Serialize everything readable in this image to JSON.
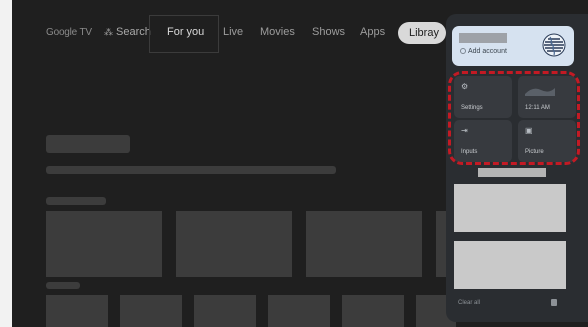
{
  "nav": {
    "logo_text": "Google TV",
    "search_label": "Search",
    "tabs": [
      {
        "label": "For you",
        "selected": true
      },
      {
        "label": "Live"
      },
      {
        "label": "Movies"
      },
      {
        "label": "Shows"
      },
      {
        "label": "Apps"
      },
      {
        "label": "Libray"
      }
    ]
  },
  "quick_settings": {
    "account": {
      "add_label": "Add account"
    },
    "tiles": [
      {
        "icon": "gear-icon",
        "label": "Settings"
      },
      {
        "icon": "clock-icon",
        "label": "12:11 AM"
      },
      {
        "icon": "input-icon",
        "label": "Inputs"
      },
      {
        "icon": "picture-icon",
        "label": "Picture"
      }
    ],
    "footer": {
      "clear_label": "Clear all",
      "trash_icon": "trash-icon"
    }
  },
  "colors": {
    "background": "#1f1f1f",
    "panel": "#2a2d31",
    "account_card": "#d6e2f0",
    "highlight_dash": "#c31a24",
    "selected_pill": "#d9d9d9"
  }
}
